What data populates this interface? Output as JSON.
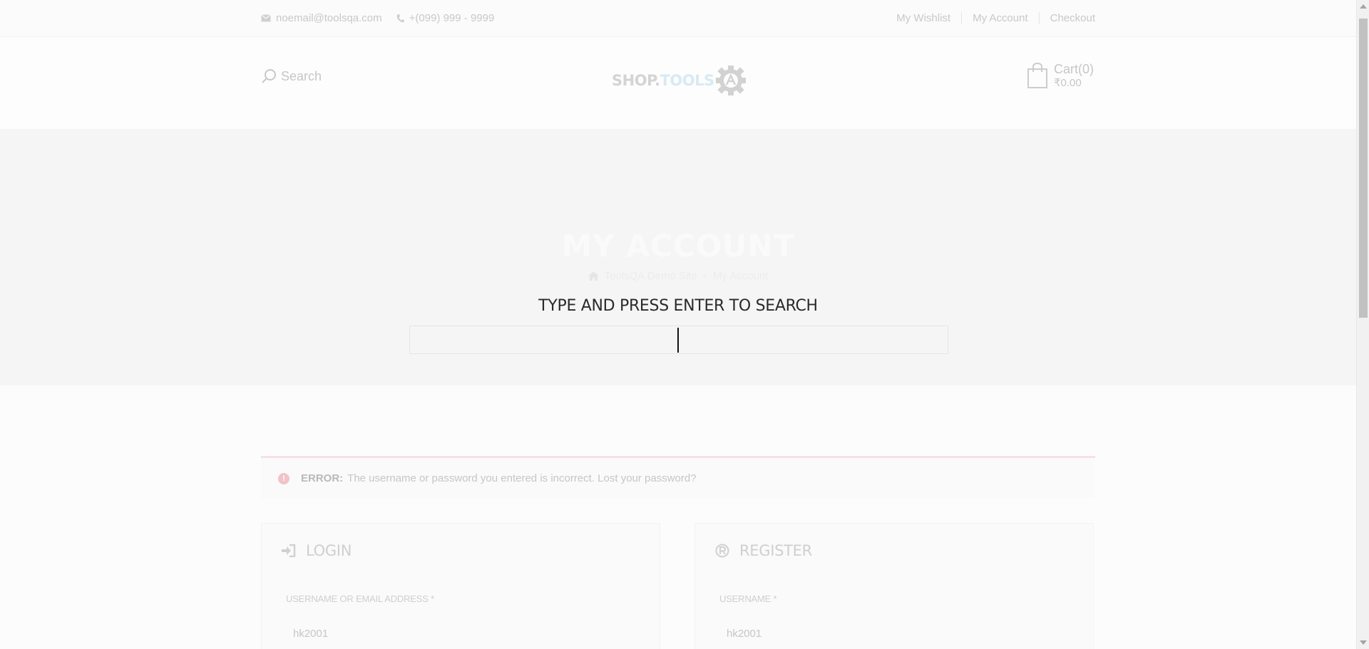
{
  "topbar": {
    "email": "noemail@toolsqa.com",
    "phone": "+(099) 999 - 9999",
    "links": [
      "My Wishlist",
      "My Account",
      "Checkout"
    ]
  },
  "header": {
    "search_label": "Search",
    "logo_part1": "SHOP.",
    "logo_part2": "TOOLS",
    "cart_label": "Cart(0)",
    "cart_total": "₹0.00"
  },
  "hero": {
    "title": "MY ACCOUNT",
    "breadcrumb_home": "ToolsQA Demo Site",
    "breadcrumb_sep": "»",
    "breadcrumb_current": "My Account"
  },
  "search_overlay": {
    "title": "TYPE AND PRESS ENTER TO SEARCH",
    "value": ""
  },
  "error": {
    "label": "ERROR:",
    "message": "The username or password you entered is incorrect. Lost your password?"
  },
  "login": {
    "title": "LOGIN",
    "field_label": "USERNAME OR EMAIL ADDRESS *",
    "field_value": "hk2001"
  },
  "register": {
    "title": "REGISTER",
    "field_label": "USERNAME *",
    "field_value": "hk2001"
  }
}
